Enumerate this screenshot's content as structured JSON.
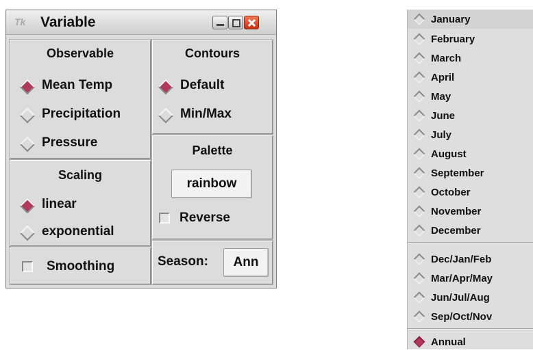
{
  "window": {
    "title": "Variable",
    "icon_label": "Tk"
  },
  "observable": {
    "header": "Observable",
    "options": [
      {
        "label": "Mean Temp",
        "selected": true
      },
      {
        "label": "Precipitation",
        "selected": false
      },
      {
        "label": "Pressure",
        "selected": false
      }
    ]
  },
  "contours": {
    "header": "Contours",
    "options": [
      {
        "label": "Default",
        "selected": true
      },
      {
        "label": "Min/Max",
        "selected": false
      }
    ]
  },
  "palette": {
    "header": "Palette",
    "button_label": "rainbow",
    "reverse_label": "Reverse",
    "reverse_checked": false
  },
  "scaling": {
    "header": "Scaling",
    "options": [
      {
        "label": "linear",
        "selected": true
      },
      {
        "label": "exponential",
        "selected": false
      }
    ]
  },
  "smoothing": {
    "label": "Smoothing",
    "checked": false
  },
  "season": {
    "label": "Season:",
    "button_label": "Ann"
  },
  "season_menu": {
    "months": [
      "January",
      "February",
      "March",
      "April",
      "May",
      "June",
      "July",
      "August",
      "September",
      "October",
      "November",
      "December"
    ],
    "seasons": [
      "Dec/Jan/Feb",
      "Mar/Apr/May",
      "Jun/Jul/Aug",
      "Sep/Oct/Nov"
    ],
    "annual": "Annual",
    "selected": "Annual"
  },
  "colors": {
    "selected_radio": "#b03a5a",
    "background": "#dcdcdc",
    "close_button": "#d9431f"
  }
}
